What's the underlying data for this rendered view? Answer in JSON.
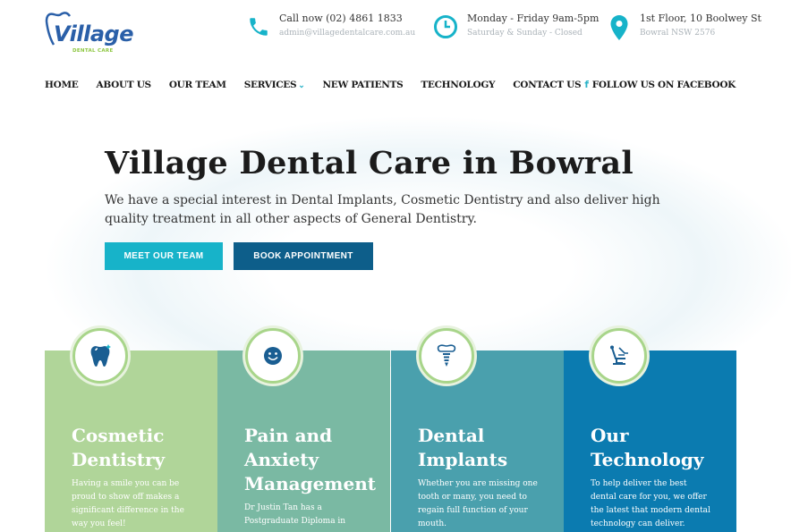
{
  "brand": {
    "logo_word": "Village",
    "logo_sub": "DENTAL CARE"
  },
  "header": {
    "phone": {
      "line1": "Call now (02) 4861 1833",
      "line2": "admin@villagedentalcare.com.au"
    },
    "hours": {
      "line1": "Monday - Friday 9am-5pm",
      "line2": "Saturday & Sunday - Closed"
    },
    "address": {
      "line1": "1st Floor, 10 Boolwey St",
      "line2": "Bowral NSW 2576"
    }
  },
  "nav": {
    "items": [
      "HOME",
      "ABOUT US",
      "OUR TEAM",
      "SERVICES",
      "NEW PATIENTS",
      "TECHNOLOGY",
      "CONTACT US"
    ],
    "facebook": "FOLLOW US ON FACEBOOK"
  },
  "hero": {
    "title": "Village Dental Care in Bowral",
    "description": "We have a special interest in Dental Implants, Cosmetic Dentistry and also deliver high quality treatment in all other aspects of General Dentistry.",
    "btn_team": "MEET OUR TEAM",
    "btn_book": "BOOK APPOINTMENT"
  },
  "cards": [
    {
      "title": "Cosmetic Dentistry",
      "text": "Having a smile you can be proud to show off makes a significant difference in the way you feel!",
      "icon": "tooth-icon"
    },
    {
      "title": "Pain and Anxiety Management",
      "text": "Dr Justin Tan has a Postgraduate Diploma in",
      "icon": "smiley-icon"
    },
    {
      "title": "Dental Implants",
      "text": "Whether you are missing one tooth or many, you need to regain full function of your mouth.",
      "icon": "implant-icon"
    },
    {
      "title": "Our Technology",
      "text": "To help deliver the best dental care for you, we offer the latest that modern dental technology can deliver.",
      "icon": "dental-chair-icon"
    }
  ],
  "colors": {
    "accent": "#17b3c9",
    "navy": "#0d5e8a",
    "green": "#b0d599"
  }
}
